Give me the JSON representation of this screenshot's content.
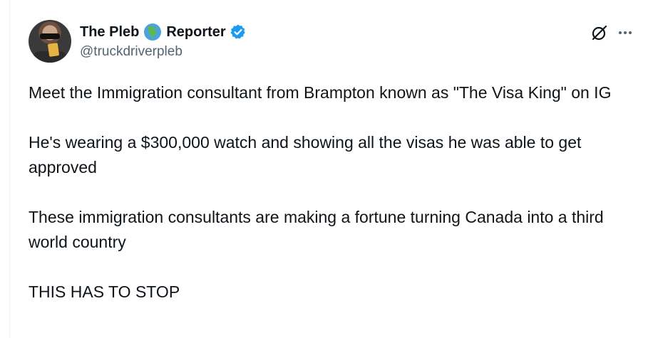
{
  "author": {
    "name_part1": "The Pleb",
    "name_emoji": "globe-africa-icon",
    "name_part2": "Reporter",
    "verified": true,
    "handle": "@truckdriverpleb"
  },
  "icons": {
    "grok": "grok-icon",
    "more": "more-icon"
  },
  "colors": {
    "text": "#0f1419",
    "secondary": "#536471",
    "verified_blue": "#1d9bf0"
  },
  "tweet": {
    "paragraphs": [
      "Meet the Immigration consultant from Brampton known as \"The Visa King\" on IG",
      "He's wearing a $300,000 watch and showing all the visas he was able to get approved",
      "These immigration consultants are making a fortune turning Canada into a third world country",
      "THIS HAS TO STOP"
    ]
  }
}
